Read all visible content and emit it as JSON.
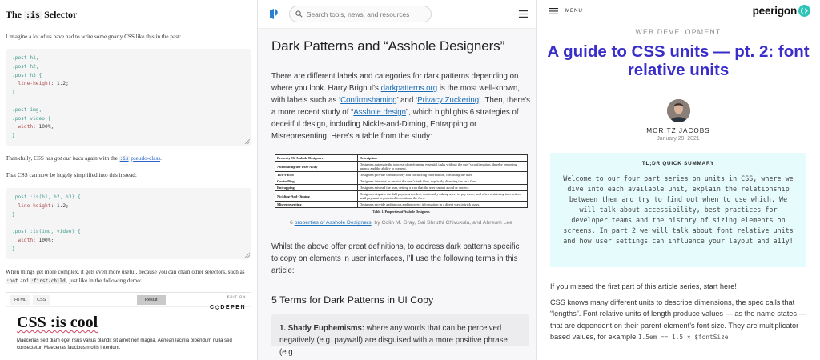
{
  "panel1": {
    "title_prefix": "The",
    "title_code": ":is",
    "title_suffix": "Selector",
    "intro": "I imagine a lot of us have had to write some gnarly CSS like this in the past:",
    "code1": [
      ".post h1,",
      ".post h2,",
      ".post h3 {",
      "  line-height: 1.2;",
      "}",
      "",
      ".post img,",
      ".post video {",
      "  width: 100%;",
      "}"
    ],
    "para2_a": "Thankfully, CSS has",
    "para2_em": "got our back",
    "para2_b": "again with the",
    "para2_code": ":is",
    "para2_link": "pseudo-class",
    "para2_end": ".",
    "para3": "That CSS can now be hugely simplified into this instead:",
    "code2": [
      ".post :is(h1, h2, h3) {",
      "  line-height: 1.2;",
      "}",
      "",
      ".post :is(img, video) {",
      "  width: 100%;",
      "}"
    ],
    "para4_a": "When things get more complex, it gets even more useful, because you can chain other selectors, such as",
    "para4_code1": ":not",
    "para4_b": "and",
    "para4_code2": ":first-child",
    "para4_c": ", just like in the following demo:",
    "codepen": {
      "tab_html": "HTML",
      "tab_css": "CSS",
      "tab_result": "Result",
      "edit_on": "EDIT ON",
      "brand": "C◇DEPEN",
      "demo_title": "CSS :is cool",
      "demo_body": "Maecenas sed diam eget risus varius blandit sit amet non magna. Aenean lacinia bibendum nulla sed consectetur. Maecenas faucibus mollis interdum."
    }
  },
  "panel2": {
    "search_placeholder": "Search tools, news, and resources",
    "title": "Dark Patterns and “Asshole Designers”",
    "intro_1": "There are different labels and categories for dark patterns depending on where you look. Harry Brignul’s",
    "link_darkpatterns": "darkpatterns.org",
    "intro_2": "is the most well-known, with labels such as ‘",
    "link_confirmshaming": "Confirmshaming",
    "intro_3": "’ and ‘",
    "link_privacy": "Privacy Zuckering",
    "intro_4": "’. Then, there’s a more recent study of “",
    "link_asshole": "Asshole design",
    "intro_5": "”, which highlights 6 strategies of deceitful design, including Nickle-and-Diming, Entrapping or Misrepresenting. Here’s a table from the study:",
    "table_headers": [
      "Property Of Asshole Designers",
      "Description"
    ],
    "table_rows": [
      [
        "Automating the User Away",
        "Designers automate the process of performing essential tasks without the user’s confirmation, thereby removing agency and the ability to consent."
      ],
      [
        "Two-Faced",
        "Designers provide contradictory and conflicting information, confusing the user."
      ],
      [
        "Controlling",
        "Designers interrupt or restrict the user’s task flow, explicitly directing the task flow."
      ],
      [
        "Entrapping",
        "Designers mislead the user, setting a trap that the user cannot avoid or correct."
      ],
      [
        "Nickling-And-Diming",
        "Designers disguise the full payment needed, continually asking users to pay more, and often restricting interaction until payment is provided to continue the flow."
      ],
      [
        "Misrepresenting",
        "Designers provide ambiguous and incorrect information in a direct way to trick users."
      ]
    ],
    "table_caption": "Table 1. Properties of Asshole Designers",
    "caption_num": "6",
    "caption_link": "properties of Asshole Designers",
    "caption_rest": ", by Colin M. Gray, Sai Shruthi Chivukula, and Ahreum Lee",
    "after_text": "Whilst the above offer great definitions, to address dark patterns specific to copy on elements in user interfaces, I’ll use the following terms in this article:",
    "h2": "5 Terms for Dark Patterns in UI Copy",
    "term1_label": "1. Shady Euphemisms:",
    "term1_text": "where any words that can be perceived negatively (e.g. paywall) are disguised with a more positive phrase (e.g."
  },
  "panel3": {
    "menu_label": "MENU",
    "brand": "peerigon",
    "category": "WEB DEVELOPMENT",
    "title": "A guide to CSS units — pt. 2: font relative units",
    "author": "MORITZ JACOBS",
    "date": "January 29, 2021",
    "summary_title": "TL;DR QUICK SUMMARY",
    "summary_text": "Welcome to our four part series on units in CSS, where we dive into each available unit, explain the relationship between them and try to find out when to use which. We will talk about accessibility, best practices for developer teams and the history of sizing elements on screens. In part 2 we will talk about font relative units and how user settings can influence your layout and a11y!",
    "para1_a": "If you missed the first part of this article series,",
    "para1_link": "start here",
    "para1_b": "!",
    "para2": "CSS knows many different units to describe dimensions, the spec calls that “lengths”. Font relative units of length produce values — as the name states — that are dependent on their parent element’s font size. They are multiplicator based values, for example",
    "para2_code": "1.5em == 1.5 × $fontSize",
    "brand_color": "#2ec4b6",
    "title_color": "#3a2ecb"
  }
}
